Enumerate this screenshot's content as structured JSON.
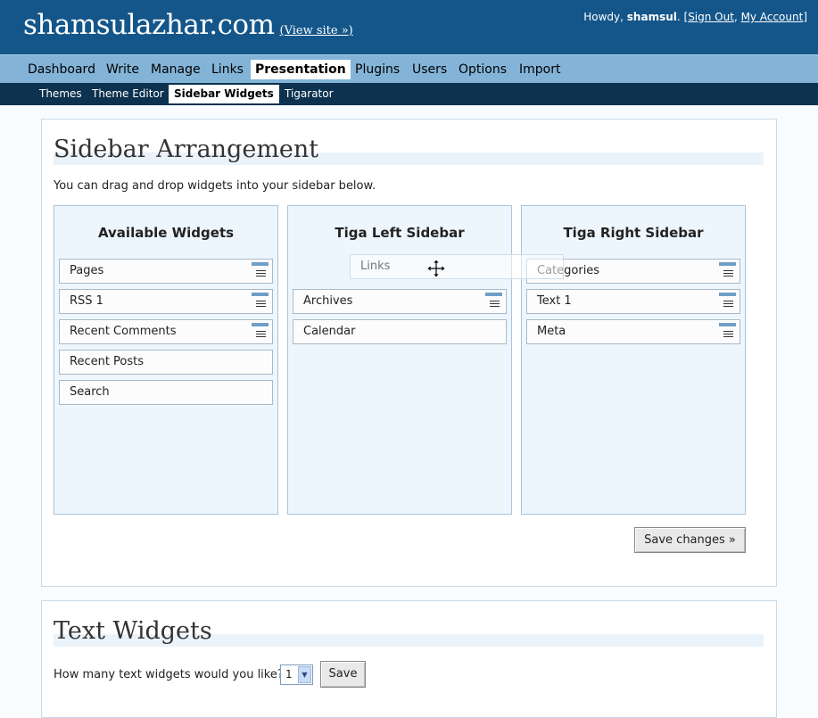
{
  "header": {
    "site_title": "shamsulazhar.com",
    "view_site": "(View site »)",
    "howdy": "Howdy, ",
    "username": "shamsul",
    "period": ". [",
    "sign_out": "Sign Out",
    "comma": ", ",
    "my_account": "My Account",
    "close_bracket": "]"
  },
  "menu": [
    "Dashboard",
    "Write",
    "Manage",
    "Links",
    "Presentation",
    "Plugins",
    "Users",
    "Options",
    "Import"
  ],
  "menu_active": "Presentation",
  "submenu": [
    "Themes",
    "Theme Editor",
    "Sidebar Widgets",
    "Tigarator"
  ],
  "submenu_active": "Sidebar Widgets",
  "arrangement": {
    "title": "Sidebar Arrangement",
    "intro": "You can drag and drop widgets into your sidebar below.",
    "available": {
      "title": "Available Widgets",
      "widgets": [
        "Pages",
        "RSS 1",
        "Recent Comments",
        "Recent Posts",
        "Search"
      ]
    },
    "left": {
      "title": "Tiga Left Sidebar",
      "widgets": [
        "Archives",
        "Calendar"
      ]
    },
    "right": {
      "title": "Tiga Right Sidebar",
      "widgets": [
        "Categories",
        "Text 1",
        "Meta"
      ]
    },
    "dragging": "Links",
    "save_label": "Save changes »"
  },
  "text_widgets": {
    "title": "Text Widgets",
    "question": "How many text widgets would you like?",
    "count": "1",
    "save_label": "Save"
  }
}
